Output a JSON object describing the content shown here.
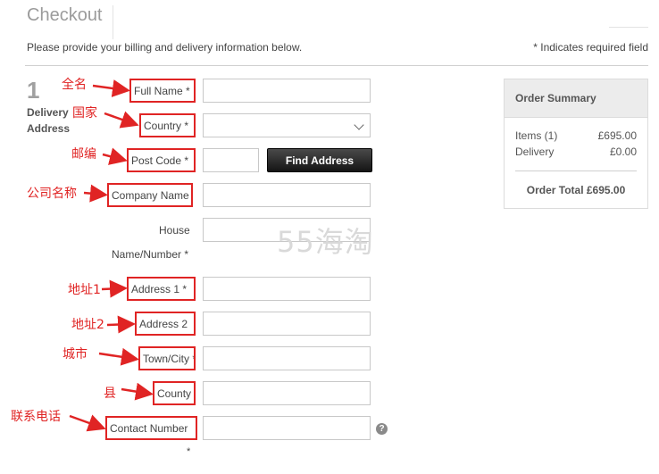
{
  "header": {
    "title": "Checkout",
    "intro": "Please provide your billing and delivery information below.",
    "required_note": "* Indicates required field"
  },
  "step": {
    "number": "1",
    "label_line1": "Delivery",
    "label_line2": "Address"
  },
  "fields": {
    "full_name": "Full Name *",
    "country": "Country *",
    "post_code": "Post Code *",
    "company_name": "Company Name",
    "house_line1": "House",
    "house_line2": "Name/Number *",
    "address1": "Address 1 *",
    "address2": "Address 2",
    "town_city": "Town/City *",
    "county": "County",
    "contact_number": "Contact Number",
    "contact_required": "*"
  },
  "buttons": {
    "find_address": "Find Address",
    "help": "?"
  },
  "annotations": {
    "full_name": "全名",
    "country": "国家",
    "post_code": "邮编",
    "company_name": "公司名称",
    "address1": "地址1",
    "address2": "地址2",
    "town_city": "城市",
    "county": "县",
    "contact_number": "联系电话"
  },
  "watermark": "55海淘",
  "summary": {
    "title": "Order Summary",
    "items_label": "Items (1)",
    "items_value": "£695.00",
    "delivery_label": "Delivery",
    "delivery_value": "£0.00",
    "total": "Order Total £695.00"
  },
  "colors": {
    "annotation_red": "#e02424",
    "button_dark": "#1a1a1a",
    "summary_header_bg": "#ececec"
  }
}
